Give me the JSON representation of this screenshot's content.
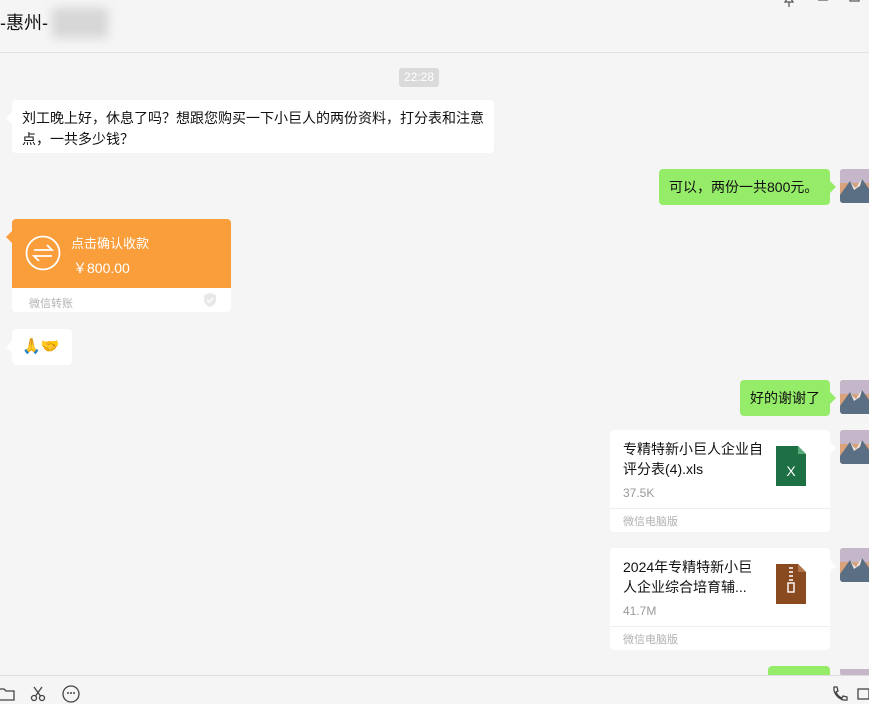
{
  "window": {
    "title": "-惠州-",
    "pin_icon": "pin-icon",
    "minimize_icon": "minimize-icon",
    "maximize_icon": "maximize-icon"
  },
  "chat": {
    "timestamp": "22:28",
    "msg1": {
      "text": "刘工晚上好，休息了吗？想跟您购买一下小巨人的两份资料，打分表和注意点，一共多少钱？"
    },
    "msg2": {
      "text": "可以，两份一共800元。"
    },
    "transfer": {
      "title": "点击确认收款",
      "amount": "￥800.00",
      "footer": "微信转账",
      "color": "#fa9d3b"
    },
    "msg3": {
      "emoji": "🙏🤝"
    },
    "msg4": {
      "text": "好的谢谢了"
    },
    "file1": {
      "name": "专精特新小巨人企业自评分表(4).xls",
      "size": "37.5K",
      "footer": "微信电脑版",
      "icon": "excel-file-icon",
      "icon_label": "X",
      "color": "#1d7044"
    },
    "file2": {
      "name": "2024年专精特新小巨人企业综合培育辅...",
      "size": "41.7M",
      "footer": "微信电脑版",
      "icon": "zip-file-icon",
      "color": "#8a4a1f"
    }
  },
  "toolbar": {
    "icons": [
      "folder-icon",
      "scissors-icon",
      "emoji-icon",
      "phone-icon",
      "video-icon"
    ]
  }
}
